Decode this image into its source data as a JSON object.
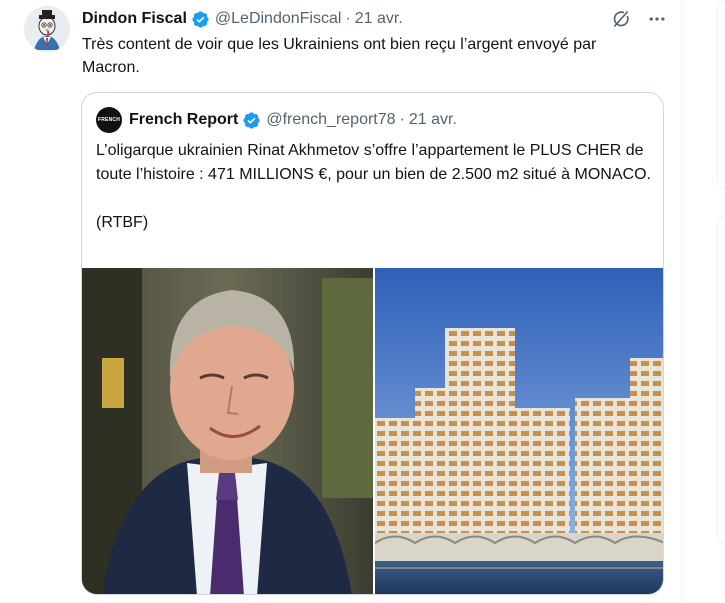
{
  "tweet": {
    "author_name": "Dindon Fiscal",
    "author_handle": "@LeDindonFiscal",
    "separator": "·",
    "date": "21 avr.",
    "text": "Très content de voir que les Ukrainiens ont bien reçu l’argent envoyé par Macron."
  },
  "quoted_tweet": {
    "author_name": "French Report",
    "author_handle": "@french_report78",
    "separator": "·",
    "date": "21 avr.",
    "avatar_text": "FRENCH",
    "text_line1": "L’oligarque ukrainien Rinat Akhmetov s’offre l’appartement le PLUS CHER de toute l’histoire : 471 MILLIONS €, pour un bien de 2.500 m2 situé à MONACO.",
    "text_line2": "(RTBF)"
  },
  "icons": {
    "verified": "verified-badge-icon",
    "grok": "grok-icon",
    "more": "more-icon"
  },
  "colors": {
    "verified": "#1d9bf0",
    "secondary_text": "#536471",
    "border": "#cfd9de"
  }
}
